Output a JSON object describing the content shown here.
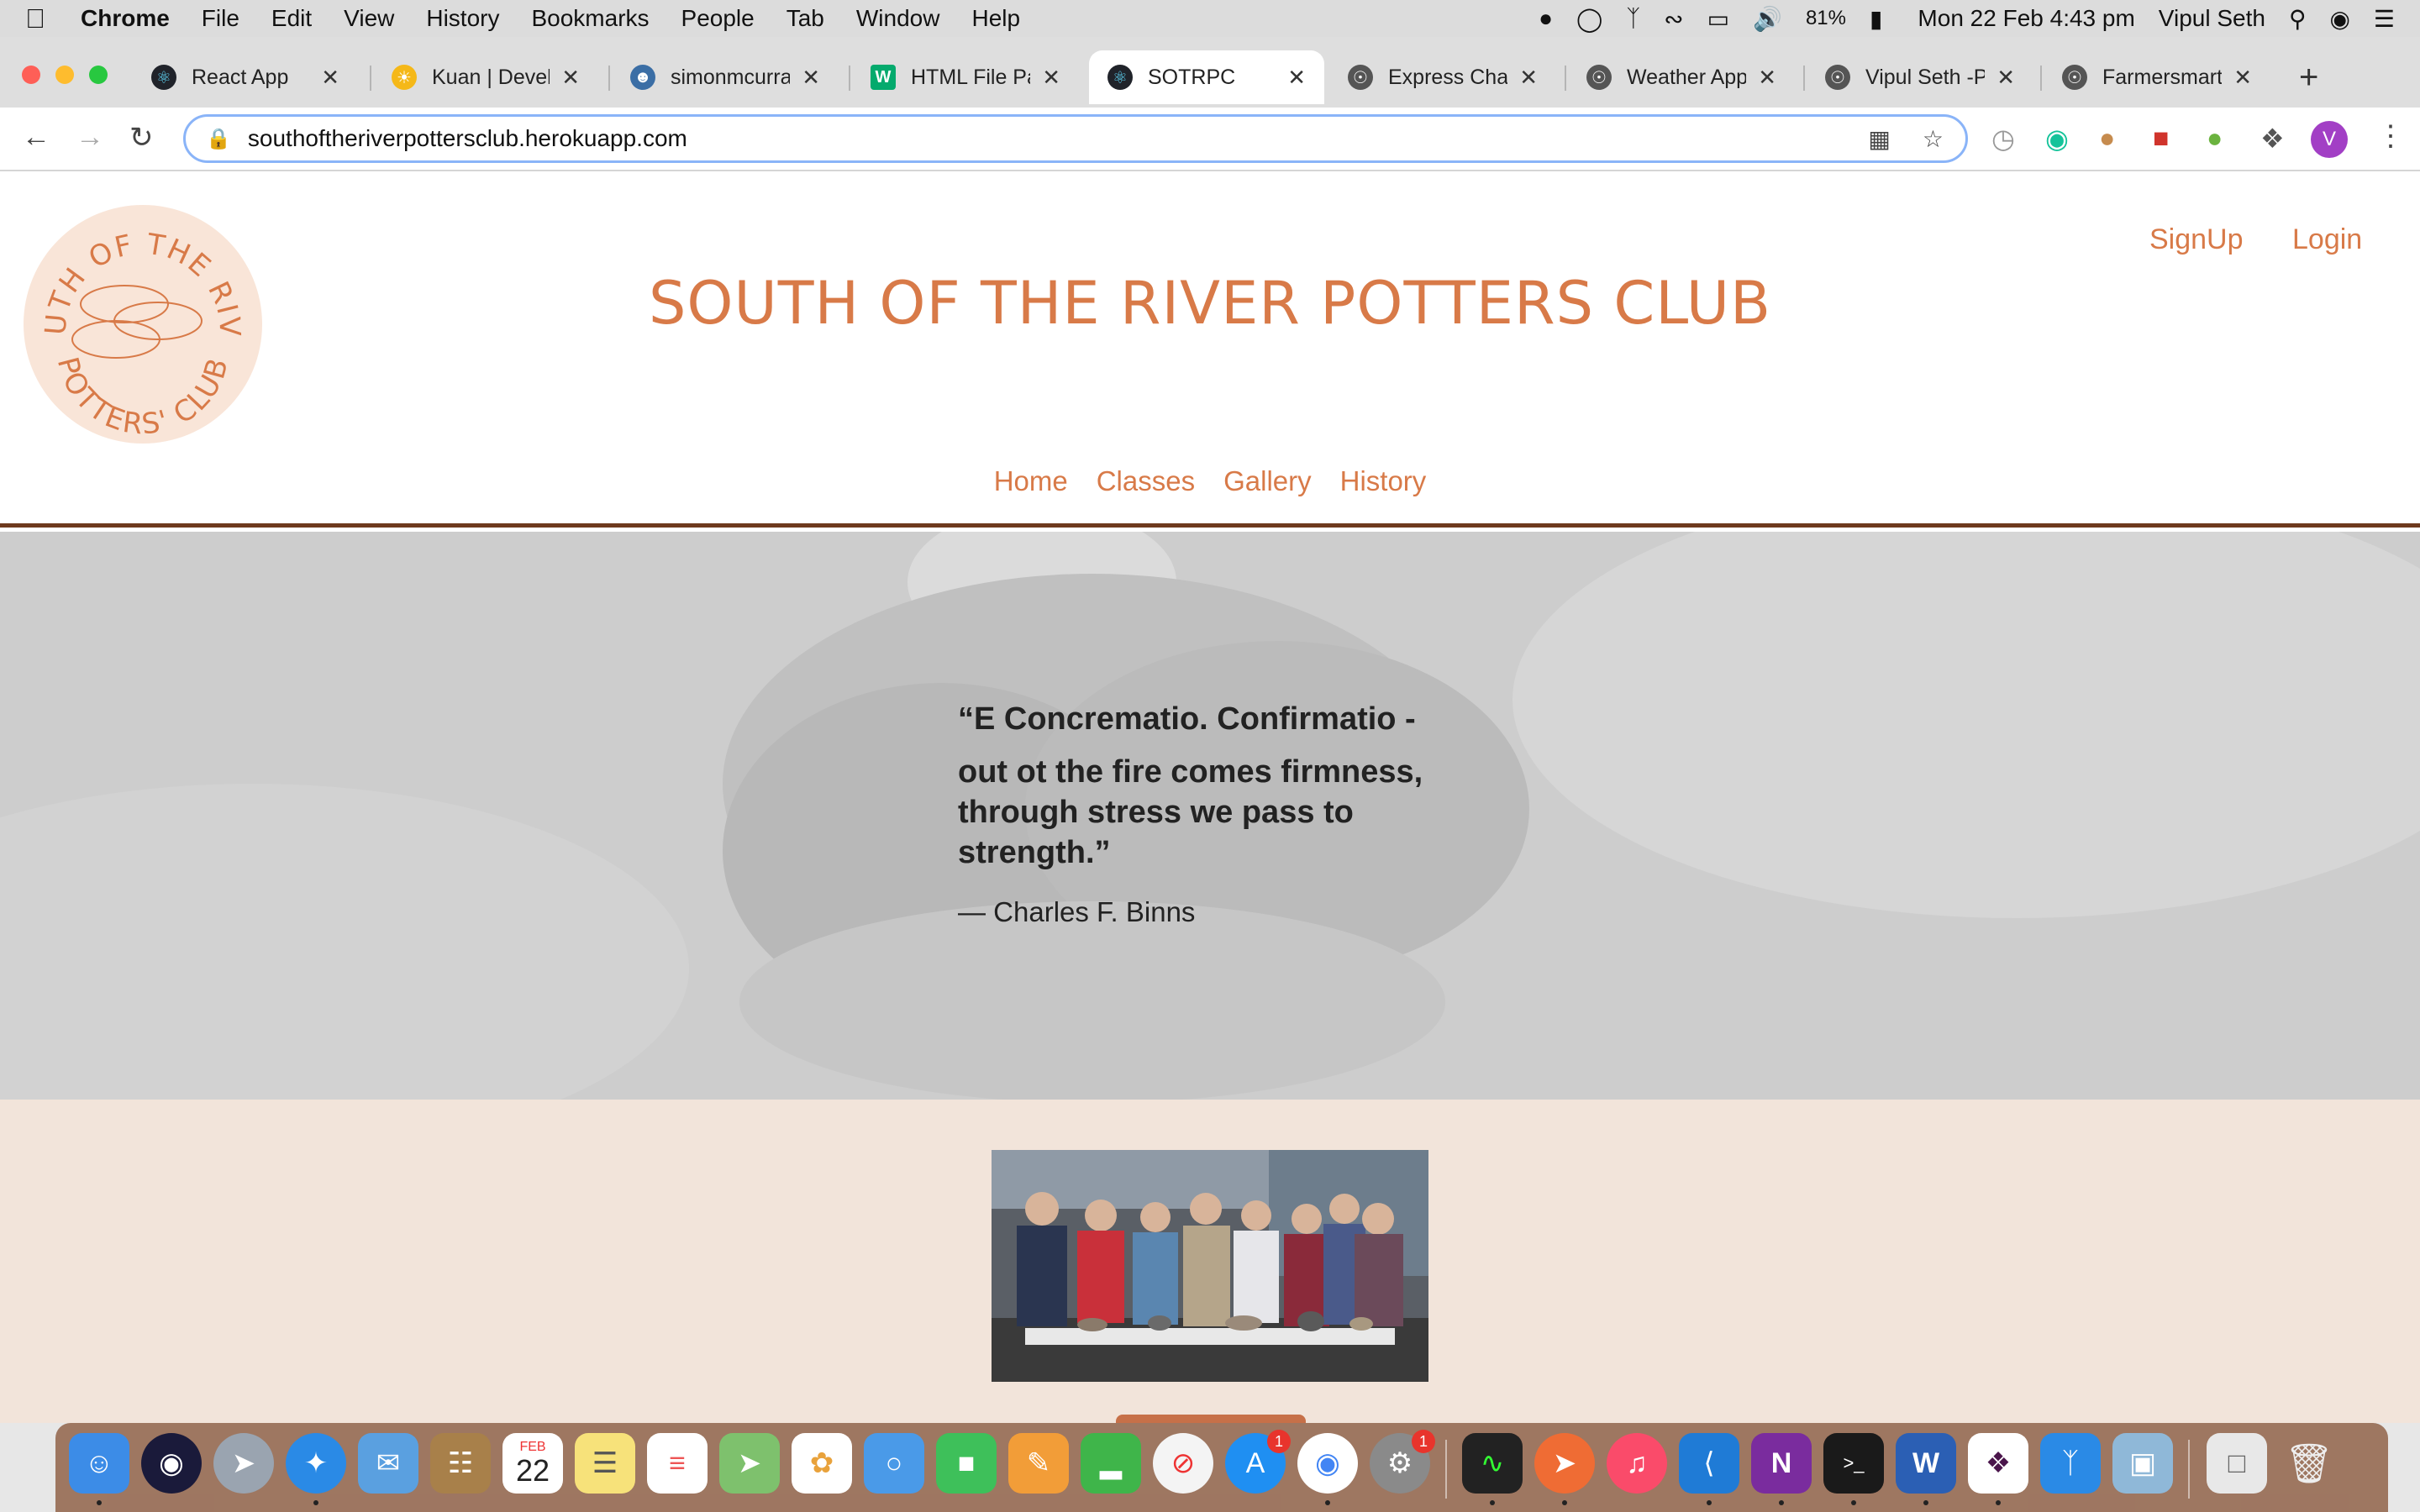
{
  "menubar": {
    "apple_icon": "apple-logo-icon",
    "app_name": "Chrome",
    "items": [
      "File",
      "Edit",
      "View",
      "History",
      "Bookmarks",
      "People",
      "Tab",
      "Window",
      "Help"
    ],
    "battery": "81%",
    "datetime": "Mon 22 Feb  4:43 pm",
    "user": "Vipul Seth"
  },
  "tabs": [
    {
      "label": "React App",
      "color": "#20232a"
    },
    {
      "label": "Kuan | Develo",
      "color": "#f5b818"
    },
    {
      "label": "simonmcurrar",
      "color": "#3b6ea5"
    },
    {
      "label": "HTML File Pat",
      "color": "#04aa6d"
    },
    {
      "label": "SOTRPC",
      "color": "#20232a"
    },
    {
      "label": "Express Chat",
      "color": "#555555"
    },
    {
      "label": "Weather App",
      "color": "#555555"
    },
    {
      "label": "Vipul Seth -P",
      "color": "#555555"
    },
    {
      "label": "Farmersmart",
      "color": "#555555"
    }
  ],
  "active_tab_index": 4,
  "omnibox": {
    "url": "southoftheriverpottersclub.herokuapp.com"
  },
  "profile_initial": "V",
  "site": {
    "logo_text_top": "SOUTH OF THE RIVER",
    "logo_text_bottom": "POTTERS' CLUB",
    "title": "SOUTH OF THE RIVER POTTERS CLUB",
    "signup": "SignUp",
    "login": "Login",
    "nav": [
      "Home",
      "Classes",
      "Gallery",
      "History"
    ],
    "quote_line1": "“E Concrematio. Confirmatio -",
    "quote_line2": "out ot the fire comes firmness, through stress we pass to strength.”",
    "quote_author": "— Charles F. Binns"
  },
  "colors": {
    "brand_orange": "#d87a48",
    "header_border": "#6e3a1e",
    "section_bg": "#f2e4da"
  },
  "dock": {
    "calendar_month": "FEB",
    "calendar_day": "22",
    "app_store_badge": "1",
    "system_prefs_badge": "1"
  }
}
